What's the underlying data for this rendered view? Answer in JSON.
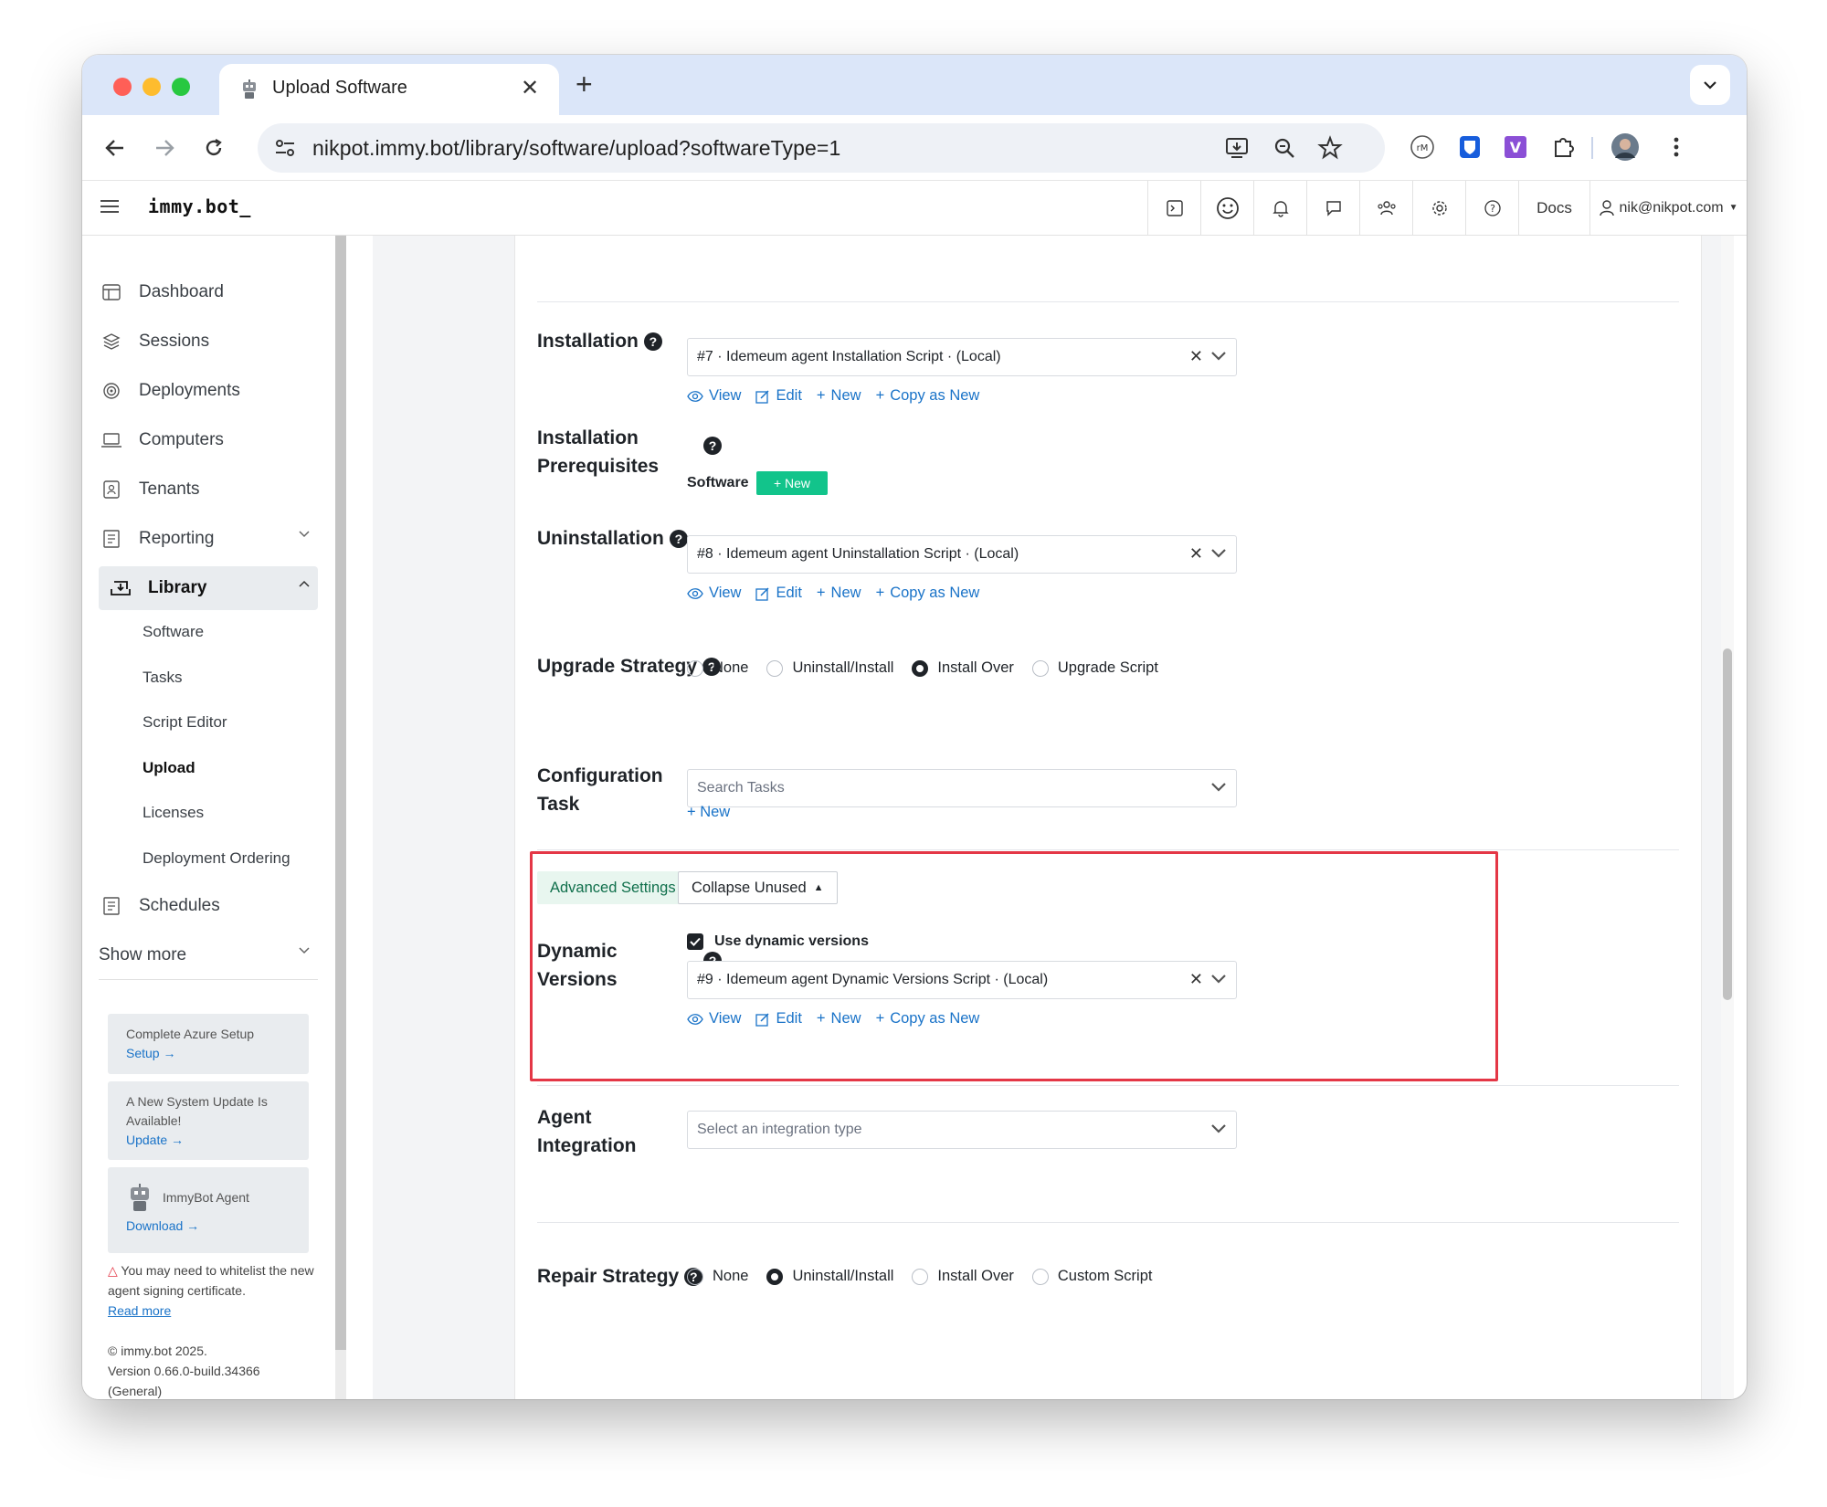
{
  "browser": {
    "tab_title": "Upload Software",
    "url": "nikpot.immy.bot/library/software/upload?softwareType=1"
  },
  "app": {
    "logo": "immy.bot_",
    "docs": "Docs",
    "user": "nik@nikpot.com"
  },
  "sidebar": {
    "items": [
      {
        "label": "Dashboard"
      },
      {
        "label": "Sessions"
      },
      {
        "label": "Deployments"
      },
      {
        "label": "Computers"
      },
      {
        "label": "Tenants"
      },
      {
        "label": "Reporting"
      },
      {
        "label": "Library"
      },
      {
        "label": "Schedules"
      },
      {
        "label": "Show more"
      }
    ],
    "library_sub": [
      "Software",
      "Tasks",
      "Script Editor",
      "Upload",
      "Licenses",
      "Deployment Ordering"
    ],
    "cards": {
      "azure_title": "Complete Azure Setup",
      "azure_link": "Setup",
      "update_title": "A New System Update Is Available!",
      "update_link": "Update",
      "agent_title": "ImmyBot Agent",
      "agent_link": "Download"
    },
    "warning": "You may need to whitelist the new agent signing certificate.",
    "read_more": "Read more",
    "footer_copy": "© immy.bot 2025.",
    "footer_version": "Version 0.66.0-build.34366",
    "footer_channel": "(General)"
  },
  "form": {
    "installation": {
      "label": "Installation",
      "value": "#7 · Idemeum agent Installation Script · (Local)"
    },
    "actions": {
      "view": "View",
      "edit": "Edit",
      "new": "New",
      "copy": "Copy as New"
    },
    "prerequisites": {
      "label_line1": "Installation",
      "label_line2": "Prerequisites",
      "software": "Software",
      "new_btn": "+ New"
    },
    "uninstallation": {
      "label": "Uninstallation",
      "value": "#8 · Idemeum agent Uninstallation Script · (Local)"
    },
    "upgrade": {
      "label": "Upgrade Strategy",
      "options": [
        "None",
        "Uninstall/Install",
        "Install Over",
        "Upgrade Script"
      ],
      "selected": "Install Over"
    },
    "config_task": {
      "label_line1": "Configuration",
      "label_line2": "Task",
      "placeholder": "Search Tasks",
      "new_link": "+ New"
    },
    "advanced": {
      "tab": "Advanced Settings",
      "collapse": "Collapse Unused"
    },
    "dynamic": {
      "label_line1": "Dynamic",
      "label_line2": "Versions",
      "checkbox": "Use dynamic versions",
      "value": "#9 · Idemeum agent Dynamic Versions Script · (Local)"
    },
    "agent": {
      "label_line1": "Agent",
      "label_line2": "Integration",
      "placeholder": "Select an integration type"
    },
    "repair": {
      "label": "Repair Strategy",
      "options": [
        "None",
        "Uninstall/Install",
        "Install Over",
        "Custom Script"
      ],
      "selected": "Uninstall/Install"
    }
  },
  "colors": {
    "link": "#1a73c8",
    "highlight": "#e43746",
    "green": "#12c48b"
  }
}
